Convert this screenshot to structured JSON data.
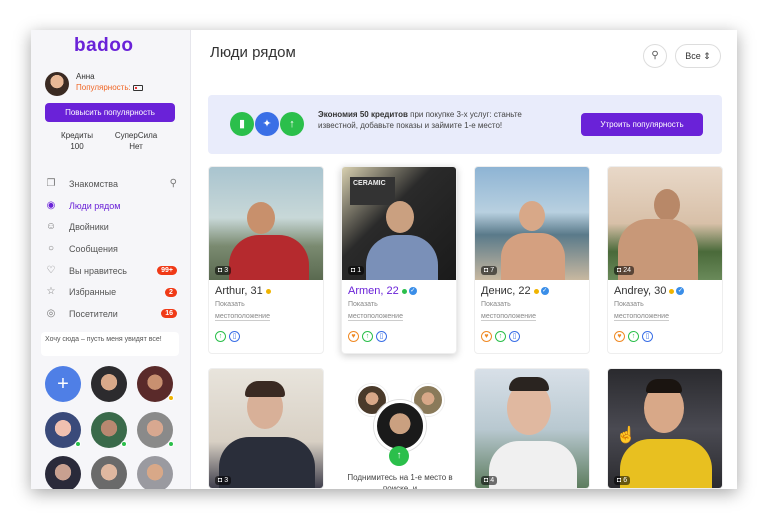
{
  "sidebar": {
    "logo": "badoo",
    "user_name": "Анна",
    "popularity_label": "Популярность:",
    "boost_button": "Повысить популярность",
    "credits_label": "Кредиты",
    "credits_value": "100",
    "superpower_label": "СуперСила",
    "superpower_value": "Нет",
    "nav": [
      {
        "label": "Знакомства",
        "icon": "cards-icon"
      },
      {
        "label": "Люди рядом",
        "icon": "location-icon"
      },
      {
        "label": "Двойники",
        "icon": "faces-icon"
      },
      {
        "label": "Сообщения",
        "icon": "chat-icon"
      },
      {
        "label": "Вы нравитесь",
        "icon": "heart-icon",
        "badge": "99+"
      },
      {
        "label": "Избранные",
        "icon": "star-icon",
        "badge": "2"
      },
      {
        "label": "Посетители",
        "icon": "eye-icon",
        "badge": "16"
      }
    ],
    "wish_text": "Хочу сюда – пусть меня увидят все!"
  },
  "main": {
    "title": "Люди рядом",
    "filter_select": "Все",
    "promo": {
      "text_bold": "Экономия 50 кредитов",
      "text_rest": " при покупке 3-х услуг: станьте известной, добавьте показы и займите 1-е место!",
      "button": "Утроить популярность"
    },
    "cards": [
      {
        "name": "Arthur, 31",
        "photos": "3",
        "loc1": "Показать",
        "loc2": "местоположение",
        "online": "#f0b400",
        "verified": false
      },
      {
        "name": "Armen, 22",
        "photos": "1",
        "loc1": "Показать",
        "loc2": "местоположение",
        "online": "#2bbf4b",
        "verified": true
      },
      {
        "name": "Денис, 22",
        "photos": "7",
        "loc1": "Показать",
        "loc2": "местоположение",
        "online": "#f0b400",
        "verified": true
      },
      {
        "name": "Andrey, 30",
        "photos": "24",
        "loc1": "Показать",
        "loc2": "местоположение",
        "online": "#f0b400",
        "verified": true
      },
      {
        "name": "",
        "photos": "3"
      },
      {
        "name": "",
        "photos": "4"
      },
      {
        "name": "",
        "photos": "6"
      }
    ],
    "promo_card_text": "Поднимитесь на 1-е место в поиске, и"
  },
  "colors": {
    "accent": "#6a22d8",
    "badge": "#f03a17"
  }
}
